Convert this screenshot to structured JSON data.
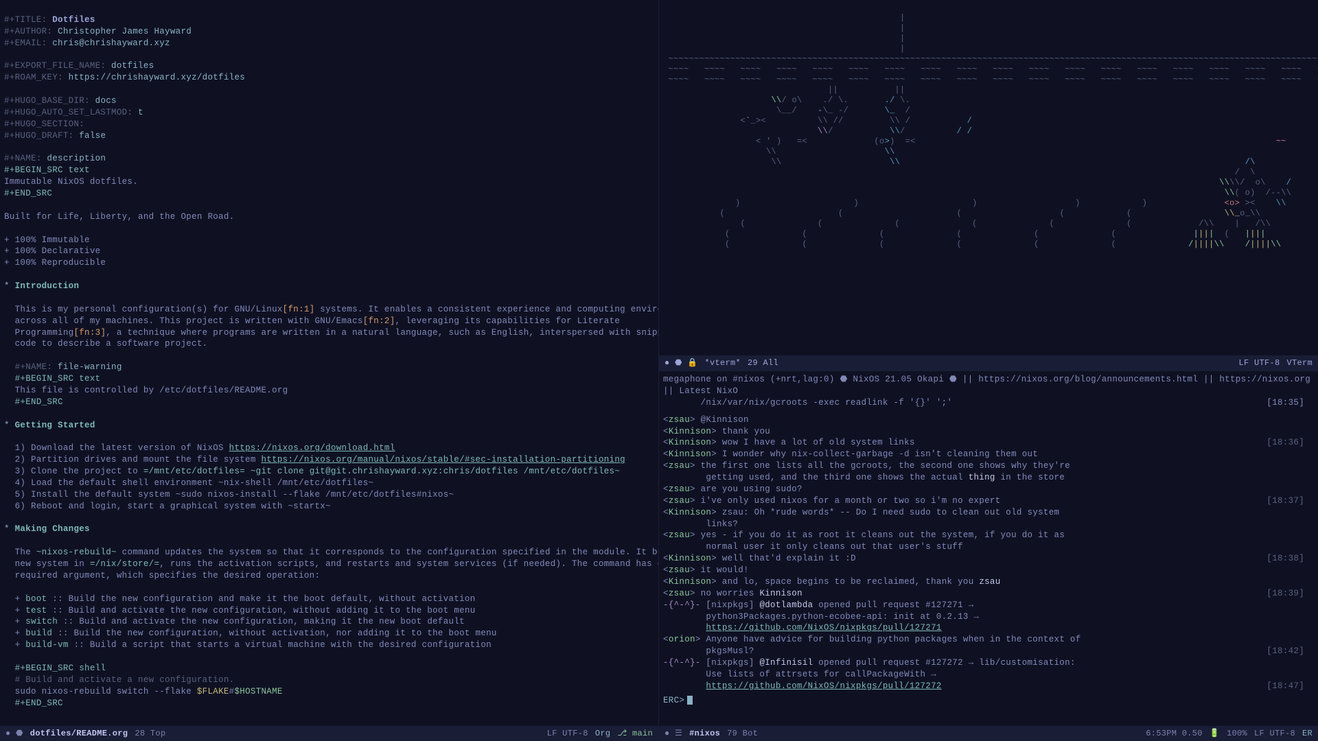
{
  "editor": {
    "meta": {
      "title_kw": "#+TITLE:",
      "title": "Dotfiles",
      "author_kw": "#+AUTHOR:",
      "author": "Christopher James Hayward",
      "email_kw": "#+EMAIL:",
      "email": "chris@chrishayward.xyz",
      "export_kw": "#+EXPORT_FILE_NAME:",
      "export": "dotfiles",
      "roam_kw": "#+ROAM_KEY:",
      "roam": "https://chrishayward.xyz/dotfiles",
      "hugo_base_kw": "#+HUGO_BASE_DIR:",
      "hugo_base": "docs",
      "hugo_lastmod_kw": "#+HUGO_AUTO_SET_LASTMOD:",
      "hugo_lastmod": "t",
      "hugo_section_kw": "#+HUGO_SECTION:",
      "hugo_section": "",
      "hugo_draft_kw": "#+HUGO_DRAFT:",
      "hugo_draft": "false"
    },
    "desc": {
      "name_kw": "#+NAME:",
      "name": "description",
      "begin": "#+BEGIN_SRC text",
      "line": "Immutable NixOS dotfiles.",
      "end": "#+END_SRC"
    },
    "tagline": "Built for Life, Liberty, and the Open Road.",
    "bullets": [
      "+ 100% Immutable",
      "+ 100% Declarative",
      "+ 100% Reproducible"
    ],
    "intro": {
      "title": "Introduction",
      "p1a": "This is my personal configuration(s) for GNU/Linux",
      "fn1": "[fn:1]",
      "p1b": " systems. It enables a consistent experience and computing environment",
      "p2a": "across all of my machines. This project is written with GNU/Emacs",
      "fn2": "[fn:2]",
      "p2b": ", leveraging its capabilities for Literate",
      "p3a": "Programming",
      "fn3": "[fn:3]",
      "p3b": ", a technique where programs are written in a natural language, such as English, interspersed with snippets of",
      "p4": "code to describe a software project."
    },
    "filewarning": {
      "name_kw": "#+NAME:",
      "name": "file-warning",
      "begin": "#+BEGIN_SRC text",
      "line": "This file is controlled by /etc/dotfiles/README.org",
      "end": "#+END_SRC"
    },
    "getting": {
      "title": "Getting Started",
      "l1a": "1) Download the latest version of NixOS ",
      "l1b": "https://nixos.org/download.html",
      "l2a": "2) Partition drives and mount the file system ",
      "l2b": "https://nixos.org/manual/nixos/stable/#sec-installation-partitioning",
      "l3a": "3) Clone the project to ",
      "l3b": "=/mnt/etc/dotfiles=",
      "l3c": " ~git clone git@git.chrishayward.xyz:chris/dotfiles /mnt/etc/dotfiles~",
      "l4": "4) Load the default shell environment ~nix-shell /mnt/etc/dotfiles~",
      "l5": "5) Install the default system ~sudo nixos-install --flake /mnt/etc/dotfiles#nixos~",
      "l6": "6) Reboot and login, start a graphical system with ~startx~"
    },
    "making": {
      "title": "Making Changes",
      "p1a": "The ",
      "p1b": "~nixos-rebuild~",
      "p1c": " command updates the system so that it corresponds to the configuration specified in the module. It builds the",
      "p2a": "new system in ",
      "p2b": "=/nix/store/=",
      "p2c": ", runs the activation scripts, and restarts and system services (if needed). The command has one",
      "p3": "required argument, which specifies the desired operation:",
      "ops": [
        {
          "k": "boot",
          "v": " :: Build the new configuration and make it the boot default, without activation"
        },
        {
          "k": "test",
          "v": " :: Build and activate the new configuration, without adding it to the boot menu"
        },
        {
          "k": "switch",
          "v": " :: Build and activate the new configuration, making it the new boot default"
        },
        {
          "k": "build",
          "v": " :: Build the new configuration, without activation, nor adding it to the boot menu"
        },
        {
          "k": "build-vm",
          "v": " :: Build a script that starts a virtual machine with the desired configuration"
        }
      ],
      "begin": "#+BEGIN_SRC shell",
      "comment": "# Build and activate a new configuration.",
      "cmd_a": "sudo nixos-rebuild switch --flake ",
      "cmd_b": "$FLAKE",
      "cmd_c": "#",
      "cmd_d": "$HOSTNAME",
      "end": "#+END_SRC"
    }
  },
  "modeline_editor": {
    "icons_left": "● ⬣",
    "file": "dotfiles/README.org",
    "pos": "28 Top",
    "enc": "LF UTF-8",
    "mode": "Org",
    "branch_icon": "⎇",
    "branch": "main"
  },
  "vterm": {
    "bar": {
      "icons": "● ⬣ 🔒",
      "buf": "*vterm*",
      "pos": "29 All",
      "enc": "LF UTF-8",
      "mode": "VTerm"
    }
  },
  "irc": {
    "header": {
      "a": "megaphone on #nixos (+nrt,lag:0) ",
      "b": "NixOS 21.05 Okapi",
      "c": " || https://nixos.org/blog/announcements.html || https://nixos.org || Latest NixO",
      "d": "/nix/var/nix/gcroots -exec readlink -f '{}' ';'",
      "t1": "[18:35]"
    },
    "lines": [
      {
        "n": "zsau",
        "m": "@Kinnison",
        "t": ""
      },
      {
        "n": "Kinnison",
        "m": "thank you",
        "t": ""
      },
      {
        "n": "Kinnison",
        "m": "wow I have a lot of old system links",
        "t": "[18:36]"
      },
      {
        "n": "Kinnison",
        "m": "I wonder why nix-collect-garbage -d isn't cleaning them out",
        "t": ""
      },
      {
        "n": "zsau",
        "m": "the first one lists all the gcroots, the second one shows why they're",
        "t": ""
      },
      {
        "cont": true,
        "m": "getting used, and the third one shows the actual ",
        "hl": "thing",
        "m2": " in the store",
        "t": ""
      },
      {
        "n": "zsau",
        "m": "are you using sudo?",
        "t": ""
      },
      {
        "n": "zsau",
        "m": "i've only used nixos for a month or two so i'm no expert",
        "t": "[18:37]"
      },
      {
        "n": "Kinnison",
        "m": "zsau: Oh *rude words* -- Do I need sudo to clean out old system",
        "t": ""
      },
      {
        "cont": true,
        "m": "links?",
        "t": ""
      },
      {
        "n": "zsau",
        "m": "yes - if you do it as root it cleans out the system, if you do it as",
        "t": ""
      },
      {
        "cont": true,
        "m": "normal user it only cleans out that user's stuff",
        "t": ""
      },
      {
        "n": "Kinnison",
        "m": "well that'd explain it :D",
        "t": "[18:38]"
      },
      {
        "n": "zsau",
        "m": "it would!",
        "t": ""
      },
      {
        "n": "Kinnison",
        "m": "and lo, space begins to be reclaimed, thank you ",
        "hl": "zsau",
        "t": ""
      },
      {
        "n": "zsau",
        "m": "no worries ",
        "hl": "Kinnison",
        "t": "[18:39]"
      },
      {
        "bot": "-{^-^}-",
        "m": "[nixpkgs] ",
        "hl": "@dotlambda",
        "m2": " opened pull request #127271 →",
        "t": ""
      },
      {
        "cont": true,
        "m": "python3Packages.python-ecobee-api: init at 0.2.13 →",
        "t": ""
      },
      {
        "cont": true,
        "lk": "https://github.com/NixOS/nixpkgs/pull/127271",
        "t": ""
      },
      {
        "n": "orion",
        "m": "Anyone have advice for building python packages when in the context of",
        "t": ""
      },
      {
        "cont": true,
        "m": "pkgsMusl?",
        "t": "[18:42]"
      },
      {
        "bot": "-{^-^}-",
        "m": "[nixpkgs] ",
        "hl": "@Infinisil",
        "m2": " opened pull request #127272 → lib/customisation:",
        "t": ""
      },
      {
        "cont": true,
        "m": "Use lists of attrsets for callPackageWith →",
        "t": ""
      },
      {
        "cont": true,
        "lk": "https://github.com/NixOS/nixpkgs/pull/127272",
        "t": "[18:47]"
      }
    ],
    "prompt": "ERC>",
    "modeline": {
      "icons": "● ☰",
      "buf": "#nixos",
      "pos": "79 Bot",
      "time": "6:53PM 0.50",
      "bat_icon": "🔋",
      "bat": "100%",
      "enc": "LF UTF-8",
      "mode": "ER"
    }
  }
}
